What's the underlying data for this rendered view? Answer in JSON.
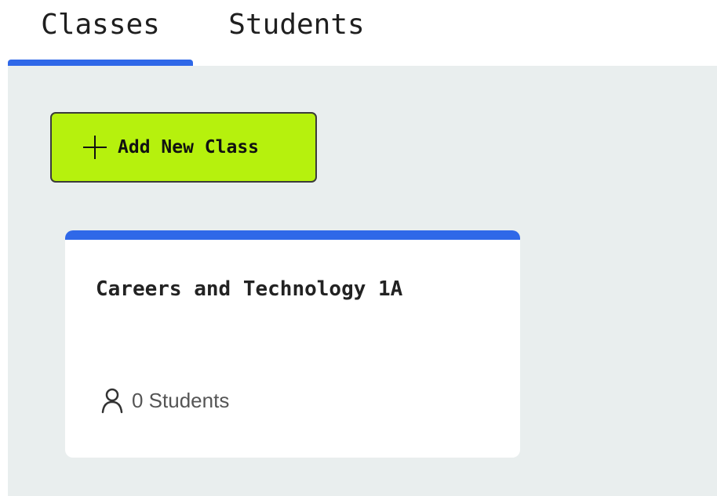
{
  "tabs": [
    {
      "label": "Classes",
      "active": true
    },
    {
      "label": "Students",
      "active": false
    }
  ],
  "toolbar": {
    "add_class_label": "Add New Class",
    "add_icon": "plus-icon"
  },
  "classes": [
    {
      "title": "Careers and Technology 1A",
      "student_count_text": "0 Students",
      "student_icon": "person-icon"
    }
  ],
  "colors": {
    "accent_blue": "#2f68e8",
    "button_green": "#b6f10d",
    "background": "#e9eeee"
  }
}
